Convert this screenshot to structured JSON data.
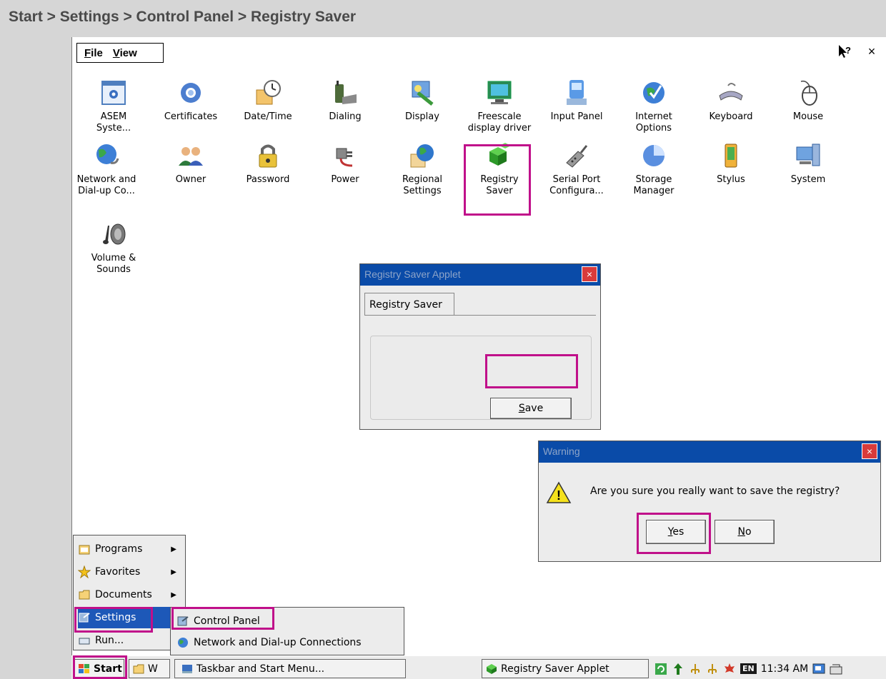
{
  "breadcrumb": "Start > Settings > Control Panel > Registry Saver",
  "menubar": {
    "file": "File",
    "view": "View"
  },
  "titlebar": {
    "help_icon": "help-cursor-icon",
    "close": "×"
  },
  "applets": [
    {
      "label": "ASEM\nSyste...",
      "icon": "asem-system-icon"
    },
    {
      "label": "Certificates",
      "icon": "certificates-icon"
    },
    {
      "label": "Date/Time",
      "icon": "clock-icon"
    },
    {
      "label": "Dialing",
      "icon": "dialing-phone-icon"
    },
    {
      "label": "Display",
      "icon": "display-icon"
    },
    {
      "label": "Freescale\ndisplay driver",
      "icon": "monitor-icon"
    },
    {
      "label": "Input Panel",
      "icon": "input-panel-icon"
    },
    {
      "label": "Internet\nOptions",
      "icon": "globe-icon"
    },
    {
      "label": "Keyboard",
      "icon": "keyboard-icon"
    },
    {
      "label": "Mouse",
      "icon": "mouse-icon"
    },
    {
      "label": "Network and\nDial-up Co...",
      "icon": "network-globe-icon"
    },
    {
      "label": "Owner",
      "icon": "users-icon"
    },
    {
      "label": "Password",
      "icon": "padlock-icon"
    },
    {
      "label": "Power",
      "icon": "power-plug-icon"
    },
    {
      "label": "Regional\nSettings",
      "icon": "regional-globe-icon"
    },
    {
      "label": "Registry\nSaver",
      "icon": "registry-cubes-icon"
    },
    {
      "label": "Serial Port\nConfigura...",
      "icon": "serial-cable-icon"
    },
    {
      "label": "Storage\nManager",
      "icon": "storage-pie-icon"
    },
    {
      "label": "Stylus",
      "icon": "stylus-icon"
    },
    {
      "label": "System",
      "icon": "system-computer-icon"
    },
    {
      "label": "Volume &\nSounds",
      "icon": "speaker-icon"
    }
  ],
  "registry_dialog": {
    "title": "Registry Saver Applet",
    "close": "×",
    "tab": "Registry Saver",
    "save_button": "Save"
  },
  "warning_dialog": {
    "title": "Warning",
    "close": "×",
    "message": "Are you sure you really want to save the registry?",
    "yes": "Yes",
    "no": "No"
  },
  "start_menu": {
    "items": [
      {
        "label": "Programs",
        "icon": "programs-icon",
        "arrow": "▶"
      },
      {
        "label": "Favorites",
        "icon": "star-icon",
        "arrow": "▶"
      },
      {
        "label": "Documents",
        "icon": "documents-icon",
        "arrow": "▶"
      },
      {
        "label": "Settings",
        "icon": "settings-icon",
        "arrow": "▶"
      },
      {
        "label": "Run...",
        "icon": "run-icon",
        "arrow": ""
      }
    ],
    "submenu": [
      {
        "label": "Control Panel",
        "icon": "control-panel-icon"
      },
      {
        "label": "Network and Dial-up Connections",
        "icon": "network-icon"
      },
      {
        "label": "Taskbar and Start Menu...",
        "icon": "taskbar-icon"
      }
    ]
  },
  "taskbar": {
    "start": "Start",
    "window1": "W",
    "active_window": "Registry Saver Applet",
    "language": "EN",
    "clock": "11:34 AM"
  },
  "colors": {
    "highlight": "#c0108a",
    "titlebar": "#0a4ba8",
    "selection": "#1d58b8"
  }
}
